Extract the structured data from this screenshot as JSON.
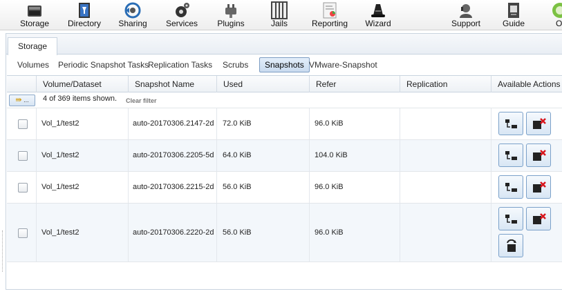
{
  "toolbar": {
    "items": [
      {
        "label": "Storage",
        "icon": "storage-icon"
      },
      {
        "label": "Directory",
        "icon": "directory-icon"
      },
      {
        "label": "Sharing",
        "icon": "sharing-icon"
      },
      {
        "label": "Services",
        "icon": "services-icon"
      },
      {
        "label": "Plugins",
        "icon": "plugins-icon"
      },
      {
        "label": "Jails",
        "icon": "jails-icon"
      },
      {
        "label": "Reporting",
        "icon": "reporting-icon"
      },
      {
        "label": "Wizard",
        "icon": "wizard-icon"
      },
      {
        "label": "Support",
        "icon": "support-icon"
      },
      {
        "label": "Guide",
        "icon": "guide-icon"
      },
      {
        "label": "Ol",
        "icon": "power-icon"
      }
    ]
  },
  "main_tab": {
    "label": "Storage"
  },
  "subtabs": [
    {
      "label": "Volumes",
      "active": false
    },
    {
      "label": "Periodic Snapshot Tasks",
      "active": false
    },
    {
      "label": "Replication Tasks",
      "active": false
    },
    {
      "label": "Scrubs",
      "active": false
    },
    {
      "label": "Snapshots",
      "active": true
    },
    {
      "label": "VMware-Snapshot",
      "active": false
    }
  ],
  "grid": {
    "columns": [
      "Volume/Dataset",
      "Snapshot Name",
      "Used",
      "Refer",
      "Replication",
      "Available Actions"
    ],
    "filter_button": "...",
    "items_shown": "4 of 369 items shown.",
    "clear_filter": "Clear filter",
    "rows": [
      {
        "dataset": "Vol_1/test2",
        "snapshot": "auto-20170306.2147-2d",
        "used": "72.0 KiB",
        "refer": "96.0 KiB",
        "replication": ""
      },
      {
        "dataset": "Vol_1/test2",
        "snapshot": "auto-20170306.2205-5d",
        "used": "64.0 KiB",
        "refer": "104.0 KiB",
        "replication": ""
      },
      {
        "dataset": "Vol_1/test2",
        "snapshot": "auto-20170306.2215-2d",
        "used": "56.0 KiB",
        "refer": "96.0 KiB",
        "replication": ""
      },
      {
        "dataset": "Vol_1/test2",
        "snapshot": "auto-20170306.2220-2d",
        "used": "56.0 KiB",
        "refer": "96.0 KiB",
        "replication": ""
      }
    ]
  },
  "colors": {
    "accent": "#7c9cc2",
    "delete_red": "#d9141b"
  }
}
